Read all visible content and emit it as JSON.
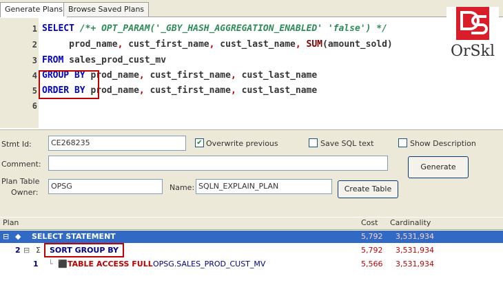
{
  "tabs": [
    {
      "label": "Generate Plans",
      "active": true
    },
    {
      "label": "Browse Saved Plans",
      "active": false
    }
  ],
  "editor": {
    "line_numbers": [
      "1",
      "2",
      "3",
      "4",
      "5",
      "6"
    ],
    "lines": [
      {
        "parts": [
          {
            "t": "SELECT ",
            "c": "kw"
          },
          {
            "t": "/*+ OPT_PARAM('_GBY_HASH_AGGREGATION_ENABLED' 'false') */",
            "c": "cm"
          }
        ]
      },
      {
        "parts": [
          {
            "t": "     prod_name",
            "c": ""
          },
          {
            "t": ", ",
            "c": "op"
          },
          {
            "t": "cust_first_name",
            "c": ""
          },
          {
            "t": ", ",
            "c": "op"
          },
          {
            "t": "cust_last_name",
            "c": ""
          },
          {
            "t": ", ",
            "c": "op"
          },
          {
            "t": "SUM",
            "c": "fn"
          },
          {
            "t": "(amount_sold)",
            "c": ""
          }
        ]
      },
      {
        "parts": [
          {
            "t": "FROM ",
            "c": "kw"
          },
          {
            "t": "sales_prod_cust_mv",
            "c": ""
          }
        ]
      },
      {
        "parts": [
          {
            "t": "GROUP BY ",
            "c": "kw"
          },
          {
            "t": "prod_name",
            "c": ""
          },
          {
            "t": ", ",
            "c": "op"
          },
          {
            "t": "cust_first_name",
            "c": ""
          },
          {
            "t": ", ",
            "c": "op"
          },
          {
            "t": "cust_last_name",
            "c": ""
          }
        ]
      },
      {
        "parts": [
          {
            "t": "ORDER BY ",
            "c": "kw"
          },
          {
            "t": "prod_name",
            "c": ""
          },
          {
            "t": ", ",
            "c": "op"
          },
          {
            "t": "cust_first_name",
            "c": ""
          },
          {
            "t": ", ",
            "c": "op"
          },
          {
            "t": "cust_last_name",
            "c": ""
          }
        ]
      },
      {
        "parts": []
      }
    ]
  },
  "logo": {
    "text": "OrSkl",
    "color": "#d81d2b"
  },
  "form": {
    "stmt_id_label": "Stmt Id:",
    "stmt_id_value": "CE268235",
    "overwrite_label": "Overwrite previous",
    "overwrite_checked": true,
    "save_sql_label": "Save SQL text",
    "save_sql_checked": false,
    "show_desc_label": "Show Description",
    "show_desc_checked": false,
    "comment_label": "Comment:",
    "comment_value": "",
    "generate_label": "Generate",
    "plan_table_label": "Plan Table",
    "owner_label": "Owner:",
    "owner_value": "OPSG",
    "name_label": "Name:",
    "name_value": "SQLN_EXPLAIN_PLAN",
    "create_table_label": "Create Table"
  },
  "plan": {
    "headers": {
      "plan": "Plan",
      "cost": "Cost",
      "cardinality": "Cardinality"
    },
    "rows": [
      {
        "id": "",
        "operation": "SELECT STATEMENT",
        "object": "",
        "cost": "5,792",
        "card": "3,531,934",
        "selected": true
      },
      {
        "id": "2",
        "operation": "SORT GROUP BY",
        "object": "",
        "cost": "5,792",
        "card": "3,531,934",
        "selected": false
      },
      {
        "id": "1",
        "operation": "TABLE ACCESS FULL",
        "object": "OPSG.SALES_PROD_CUST_MV",
        "cost": "5,566",
        "card": "3,531,934",
        "selected": false
      }
    ]
  }
}
